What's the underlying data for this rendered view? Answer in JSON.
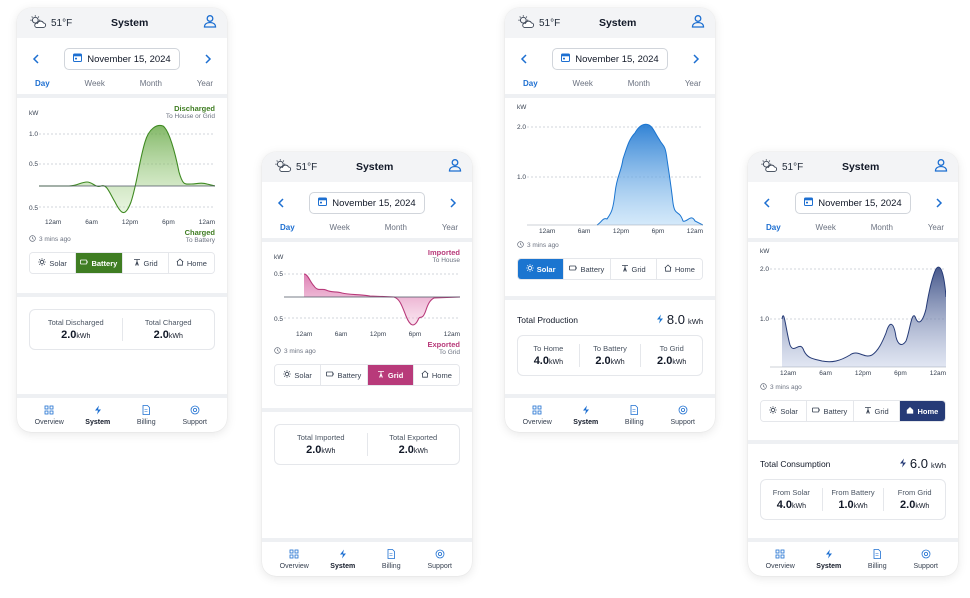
{
  "common": {
    "temperature": "51°F",
    "title": "System",
    "date": "November 15, 2024",
    "tabs": [
      "Day",
      "Week",
      "Month",
      "Year"
    ],
    "x_ticks": [
      "12am",
      "6am",
      "12pm",
      "6pm",
      "12am"
    ],
    "updated": "3 mins ago",
    "segments": [
      "Solar",
      "Battery",
      "Grid",
      "Home"
    ],
    "nav": [
      "Overview",
      "System",
      "Billing",
      "Support"
    ],
    "y_unit": "kW"
  },
  "battery": {
    "legend_top_main": "Discharged",
    "legend_top_sub": "To House or Grid",
    "legend_bottom_main": "Charged",
    "legend_bottom_sub": "To Battery",
    "y_ticks": [
      "1.0",
      "0.5",
      "0.5"
    ],
    "total_1_label": "Total Discharged",
    "total_1_value": "2.0",
    "total_2_label": "Total Charged",
    "total_2_value": "2.0",
    "unit": "kWh",
    "accent": "#3f7d22"
  },
  "grid": {
    "legend_top_main": "Imported",
    "legend_top_sub": "To House",
    "legend_bottom_main": "Exported",
    "legend_bottom_sub": "To Grid",
    "y_ticks": [
      "0.5",
      "0.5"
    ],
    "total_1_label": "Total Imported",
    "total_1_value": "2.0",
    "total_2_label": "Total Exported",
    "total_2_value": "2.0",
    "unit": "kWh",
    "accent": "#b83a7a"
  },
  "solar": {
    "y_ticks": [
      "2.0",
      "1.0"
    ],
    "summary_title": "Total Production",
    "summary_value": "8.0",
    "cells": [
      {
        "label": "To Home",
        "value": "4.0"
      },
      {
        "label": "To Battery",
        "value": "2.0"
      },
      {
        "label": "To Grid",
        "value": "2.0"
      }
    ],
    "unit": "kWh",
    "accent": "#1b75d0"
  },
  "home": {
    "y_ticks": [
      "2.0",
      "1.0"
    ],
    "summary_title": "Total Consumption",
    "summary_value": "6.0",
    "cells": [
      {
        "label": "From Solar",
        "value": "4.0"
      },
      {
        "label": "From Battery",
        "value": "1.0"
      },
      {
        "label": "From Grid",
        "value": "2.0"
      }
    ],
    "unit": "kWh",
    "accent": "#263b77"
  },
  "chart_data": [
    {
      "type": "area",
      "title": "",
      "ylabel": "kW",
      "x": [
        "12am",
        "6am",
        "12pm",
        "6pm",
        "12am"
      ],
      "series": [
        {
          "name": "Discharged",
          "values": [
            0.0,
            0.0,
            0.1,
            0.0,
            -0.6,
            0.1,
            1.1,
            1.0,
            0.0,
            0.05,
            0.0
          ]
        },
        {
          "name": "Charged",
          "values": []
        }
      ],
      "ylim": [
        -0.5,
        1.2
      ]
    },
    {
      "type": "area",
      "title": "",
      "ylabel": "kW",
      "x": [
        "12am",
        "6am",
        "12pm",
        "6pm",
        "12am"
      ],
      "series": [
        {
          "name": "Imported",
          "values": [
            0.0,
            0.5,
            0.2,
            0.1,
            0.05,
            0.0,
            -0.05,
            -0.1,
            -0.5,
            -0.4,
            -0.05,
            0.0
          ]
        },
        {
          "name": "Exported",
          "values": []
        }
      ],
      "ylim": [
        -0.6,
        0.6
      ]
    },
    {
      "type": "area",
      "title": "",
      "ylabel": "kW",
      "x": [
        "12am",
        "6am",
        "12pm",
        "6pm",
        "12am"
      ],
      "series": [
        {
          "name": "Solar",
          "values": [
            0,
            0,
            0,
            0.1,
            0.3,
            1.3,
            2.0,
            2.3,
            2.1,
            1.5,
            0.3,
            0.1,
            0
          ]
        }
      ],
      "ylim": [
        0,
        2.5
      ]
    },
    {
      "type": "area",
      "title": "",
      "ylabel": "kW",
      "x": [
        "12am",
        "6am",
        "12pm",
        "6pm",
        "12am"
      ],
      "series": [
        {
          "name": "Home",
          "values": [
            1.1,
            0.4,
            0.2,
            0.1,
            0.2,
            0.4,
            0.3,
            1.1,
            0.6,
            1.3,
            1.0,
            1.8,
            2.2,
            2.3
          ]
        }
      ],
      "ylim": [
        0,
        2.4
      ]
    }
  ]
}
